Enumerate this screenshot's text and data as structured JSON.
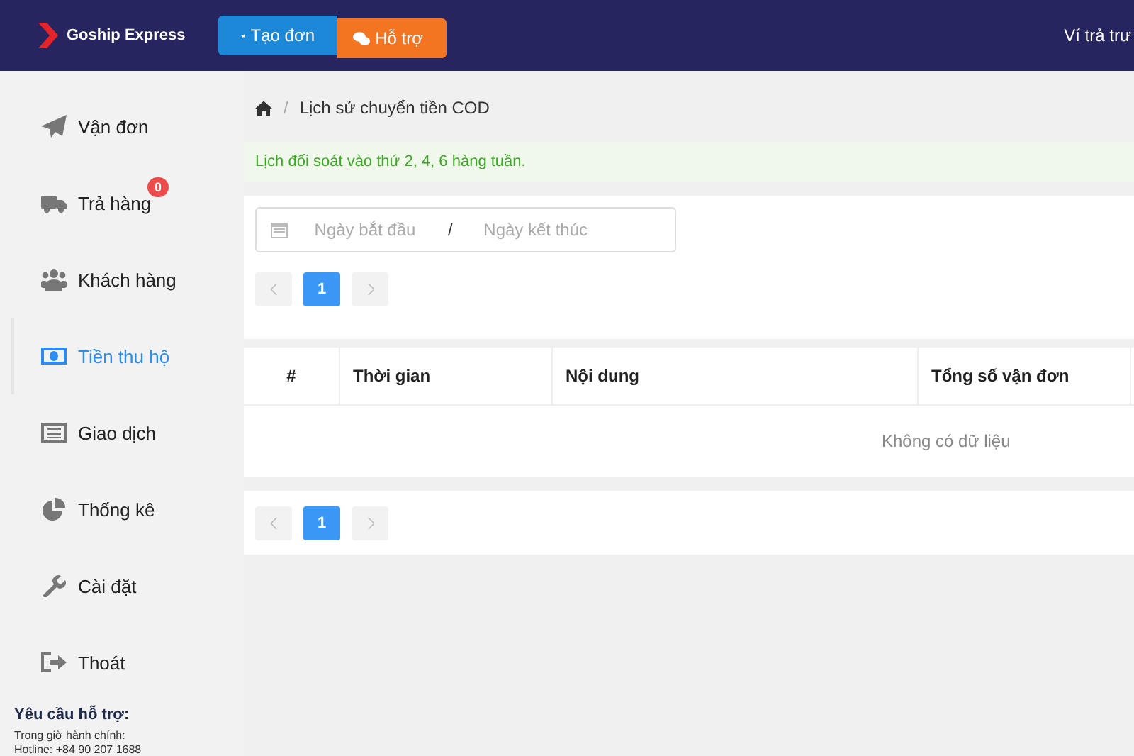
{
  "header": {
    "brand": "Goship Express",
    "buttons": [
      {
        "kind": "create",
        "label": "Tạo đơn"
      },
      {
        "kind": "support",
        "label": "Hỗ trợ"
      }
    ],
    "wallet": "Ví trả trư"
  },
  "sidebar": {
    "items": [
      {
        "label": "Vận đơn",
        "selected": false
      },
      {
        "label": "Trả hàng",
        "selected": false,
        "badge": "0"
      },
      {
        "label": "Khách hàng",
        "selected": false
      },
      {
        "label": "Tiền thu hộ",
        "selected": true
      },
      {
        "label": "Giao dịch",
        "selected": false
      },
      {
        "label": "Thống kê",
        "selected": false
      },
      {
        "label": "Cài đặt",
        "selected": false
      },
      {
        "label": "Thoát",
        "selected": false
      }
    ],
    "support": {
      "title": "Yêu cầu hỗ trợ:",
      "lines": [
        "Trong giờ hành chính:",
        "Hotline: +84 90 207 1688"
      ]
    }
  },
  "breadcrumb": {
    "separator": "/",
    "current": "Lịch sử chuyển tiền COD"
  },
  "notice": "Lịch đối soát vào thứ 2, 4, 6 hàng tuần.",
  "date_range": {
    "start_placeholder": "Ngày bắt đầu",
    "separator": "/",
    "end_placeholder": "Ngày kết thúc"
  },
  "pagination_top": {
    "pages": [
      {
        "label": "1",
        "selected": true
      }
    ]
  },
  "table": {
    "columns": [
      "#",
      "Thời gian",
      "Nội dung",
      "Tổng số vận đơn"
    ],
    "empty": "Không có dữ liệu"
  },
  "pagination_bottom": {
    "pages": [
      {
        "label": "1",
        "selected": true
      }
    ]
  }
}
